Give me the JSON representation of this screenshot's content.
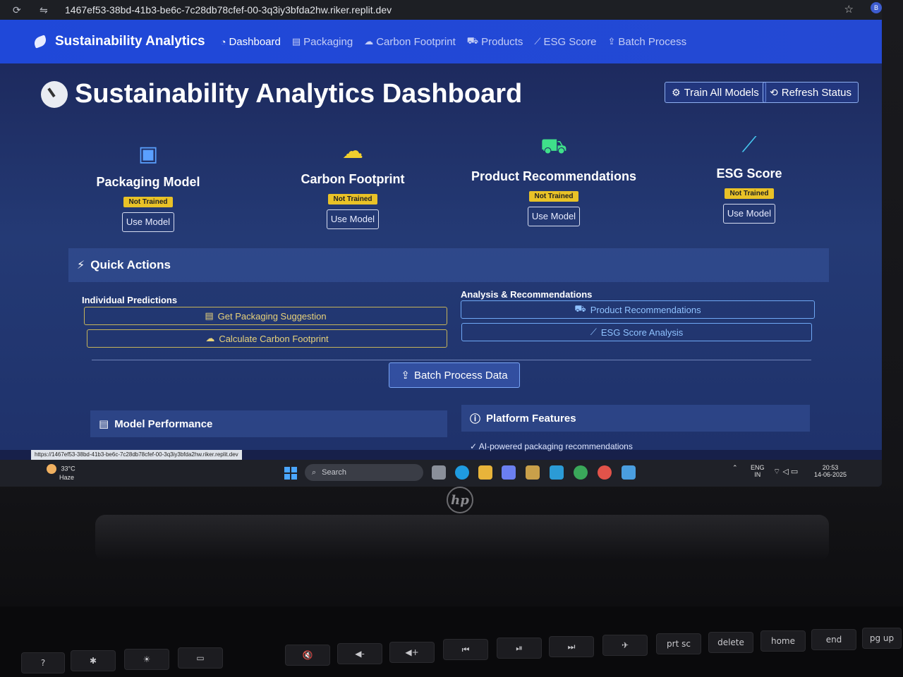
{
  "browser": {
    "url": "1467ef53-38bd-41b3-be6c-7c28db78cfef-00-3q3iy3bfda2hw.riker.replit.dev",
    "profile_initial": "B"
  },
  "navbar": {
    "brand": "Sustainability Analytics",
    "links": [
      "Dashboard",
      "Packaging",
      "Carbon Footprint",
      "Products",
      "ESG Score",
      "Batch Process"
    ]
  },
  "header": {
    "title": "Sustainability Analytics Dashboard",
    "train_all": "Train All Models",
    "refresh": "Refresh Status"
  },
  "models": [
    {
      "name": "Packaging Model",
      "status": "Not Trained",
      "action": "Use Model",
      "icon": "box-icon"
    },
    {
      "name": "Carbon Footprint",
      "status": "Not Trained",
      "action": "Use Model",
      "icon": "smog-icon"
    },
    {
      "name": "Product Recommendations",
      "status": "Not Trained",
      "action": "Use Model",
      "icon": "cart-icon"
    },
    {
      "name": "ESG Score",
      "status": "Not Trained",
      "action": "Use Model",
      "icon": "chart-line-icon"
    }
  ],
  "quick_actions": {
    "title": "Quick Actions",
    "individual_title": "Individual Predictions",
    "analysis_title": "Analysis & Recommendations",
    "packaging": "Get Packaging Suggestion",
    "carbon": "Calculate Carbon Footprint",
    "products": "Product Recommendations",
    "esg": "ESG Score Analysis",
    "batch": "Batch Process Data"
  },
  "panels": {
    "performance": "Model Performance",
    "features": "Platform Features",
    "feature_1": "AI-powered packaging recommendations"
  },
  "status_url": "https://1467ef53-38bd-41b3-be6c-7c28db78cfef-00-3q3iy3bfda2hw.riker.replit.dev",
  "taskbar": {
    "temp": "33°C",
    "weather": "Haze",
    "search": "Search",
    "lang": "ENG",
    "region": "IN",
    "time": "20:53",
    "date": "14-06-2025"
  },
  "keyboard": {
    "keys": [
      "?",
      "✱",
      "☀",
      "▭",
      "🔇",
      "◀-",
      "◀+",
      "⏮",
      "⏯",
      "⏭",
      "✈",
      "prt sc",
      "delete",
      "home",
      "end",
      "pg up"
    ]
  },
  "colors": {
    "navbar": "#1f48d9",
    "content_bg": "#243a75",
    "badge": "#e9c227",
    "icon_blue": "#5aa0ff"
  }
}
